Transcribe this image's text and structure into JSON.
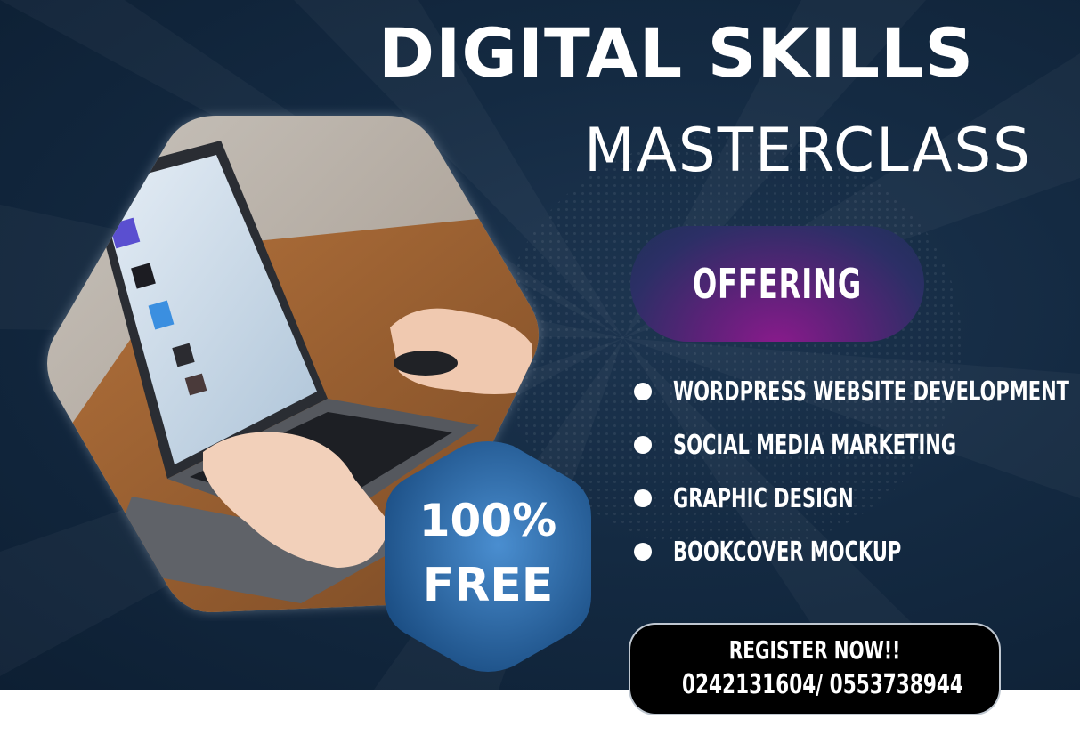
{
  "header": {
    "title_line1": "DIGITAL SKILLS",
    "title_line2": "MASTERCLASS"
  },
  "badge": {
    "percent": "100%",
    "word": "FREE"
  },
  "offering": {
    "label": "OFFERING",
    "items": [
      "WORDPRESS WEBSITE DEVELOPMENT",
      "SOCIAL MEDIA MARKETING",
      "GRAPHIC DESIGN",
      "BOOKCOVER MOCKUP"
    ]
  },
  "register": {
    "title": "REGISTER NOW!!",
    "phones": "0242131604/ 0553738944"
  },
  "colors": {
    "background": "#142a42",
    "badge": "#3a78b6",
    "offering_pill": "#7a1f86",
    "register_box": "#000000",
    "text": "#ffffff"
  },
  "icons": {
    "bullet": "bullet-dot-icon",
    "photo": "laptop-photo"
  }
}
